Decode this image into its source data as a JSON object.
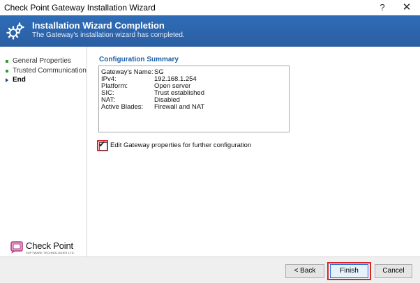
{
  "window": {
    "title": "Check Point Gateway Installation Wizard",
    "help_glyph": "?",
    "close_glyph": "✕"
  },
  "header": {
    "title": "Installation Wizard Completion",
    "subtitle": "The Gateway's installation wizard has completed.",
    "background_color": "#2b63ad",
    "icon": "gears-icon"
  },
  "sidebar": {
    "items": [
      {
        "label": "General Properties",
        "state": "done"
      },
      {
        "label": "Trusted Communication",
        "state": "done"
      },
      {
        "label": "End",
        "state": "current"
      }
    ],
    "logo": {
      "name": "Check Point",
      "tagline": "SOFTWARE TECHNOLOGIES LTD."
    }
  },
  "summary": {
    "title": "Configuration Summary",
    "rows": [
      {
        "key": "Gateway's Name:",
        "value": "SG"
      },
      {
        "key": "IPv4:",
        "value": "192.168.1.254"
      },
      {
        "key": "Platform:",
        "value": "Open server"
      },
      {
        "key": "SIC:",
        "value": "Trust established"
      },
      {
        "key": "NAT:",
        "value": "Disabled"
      },
      {
        "key": "Active Blades:",
        "value": "Firewall and NAT"
      }
    ]
  },
  "edit_checkbox": {
    "label": "Edit Gateway properties for further configuration",
    "checked": true
  },
  "buttons": {
    "back": "< Back",
    "finish": "Finish",
    "cancel": "Cancel"
  },
  "colors": {
    "accent_title": "#1d5fa8",
    "highlight_red": "#d7262b",
    "nav_bullet": "#2d9c2d"
  }
}
